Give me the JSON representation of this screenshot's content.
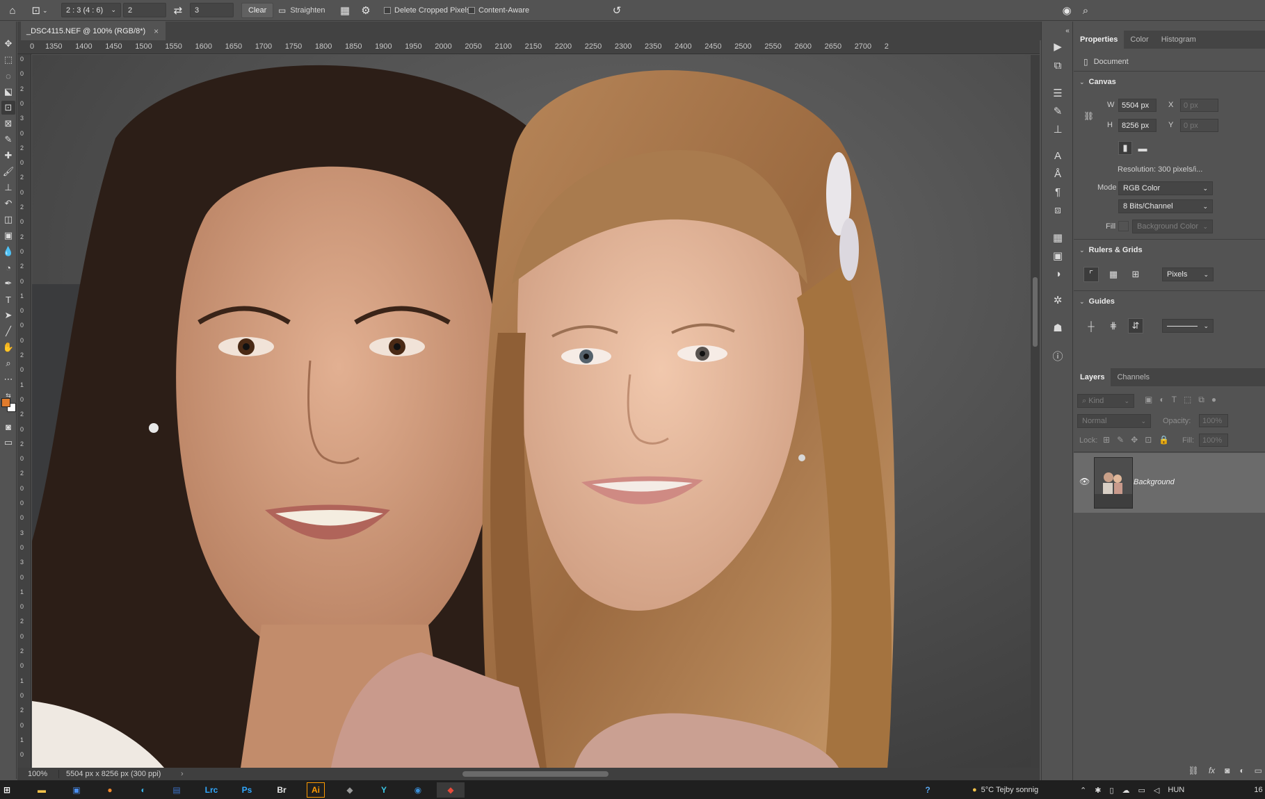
{
  "options_bar": {
    "home_icon": "home-icon",
    "crop_tool_icon": "crop-icon",
    "ratio_preset": "2 : 3 (4 : 6)",
    "width_value": "2",
    "height_value": "3",
    "clear_label": "Clear",
    "straighten_label": "Straighten",
    "delete_cropped_label": "Delete Cropped Pixels",
    "content_aware_label": "Content-Aware"
  },
  "document": {
    "tab_title": "_DSC4115.NEF @ 100% (RGB/8*)",
    "ruler_h_ticks": [
      "0",
      "1350",
      "1400",
      "1450",
      "1500",
      "1550",
      "1600",
      "1650",
      "1700",
      "1750",
      "1800",
      "1850",
      "1900",
      "1950",
      "2000",
      "2050",
      "2100",
      "2150",
      "2200",
      "2250",
      "2300",
      "2350",
      "2400",
      "2450",
      "2500",
      "2550",
      "2600",
      "2650",
      "2700",
      "2"
    ],
    "ruler_v_ticks": [
      "0",
      "0",
      "2",
      "0",
      "3",
      "0",
      "2",
      "0",
      "2",
      "0",
      "2",
      "0",
      "2",
      "0",
      "2",
      "0",
      "1",
      "0",
      "0",
      "0",
      "2",
      "0",
      "1",
      "0",
      "2",
      "0",
      "2",
      "0",
      "2",
      "0",
      "0",
      "0",
      "3",
      "0",
      "3",
      "0",
      "1",
      "0",
      "2",
      "0",
      "2",
      "0",
      "1",
      "0",
      "2",
      "0",
      "1",
      "0"
    ]
  },
  "status_bar": {
    "zoom": "100%",
    "doc_info": "5504 px x 8256 px (300 ppi)"
  },
  "properties_panel": {
    "tabs": [
      "Properties",
      "Color",
      "Histogram"
    ],
    "active_tab": "Properties",
    "document_label": "Document",
    "canvas_section": "Canvas",
    "w_label": "W",
    "w_value": "5504 px",
    "h_label": "H",
    "h_value": "8256 px",
    "x_label": "X",
    "x_placeholder": "0 px",
    "y_label": "Y",
    "y_placeholder": "0 px",
    "resolution": "Resolution: 300 pixels/i...",
    "mode_label": "Mode",
    "mode_value": "RGB Color",
    "bits_value": "8 Bits/Channel",
    "fill_label": "Fill",
    "fill_value": "Background Color",
    "rulers_section": "Rulers & Grids",
    "units_value": "Pixels",
    "guides_section": "Guides"
  },
  "layers_panel": {
    "tabs": [
      "Layers",
      "Channels"
    ],
    "active_tab": "Layers",
    "kind_placeholder": "Kind",
    "blend_mode": "Normal",
    "opacity_label": "Opacity:",
    "opacity_value": "100%",
    "lock_label": "Lock:",
    "fill_label": "Fill:",
    "fill_value": "100%",
    "layers": [
      {
        "name": "Background",
        "visible": true
      }
    ]
  },
  "taskbar": {
    "weather": "5°C  Tejby sonnig",
    "language": "HUN",
    "clock_partial": "16"
  },
  "colors": {
    "ui_bg": "#535353",
    "foreground_swatch": "#e07b2c",
    "background_swatch": "#ffffff",
    "selected_layer": "#6b6b6b"
  }
}
